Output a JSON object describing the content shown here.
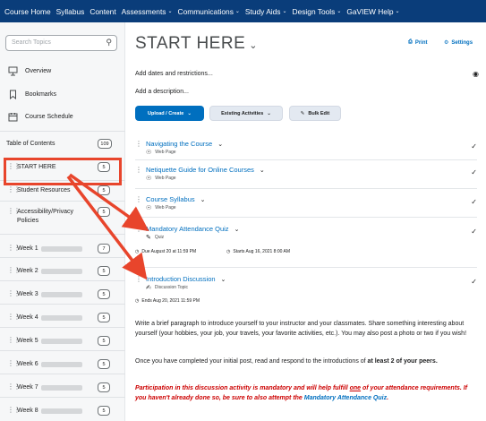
{
  "nav": {
    "items": [
      {
        "label": "Course Home",
        "menu": false
      },
      {
        "label": "Syllabus",
        "menu": false
      },
      {
        "label": "Content",
        "menu": false
      },
      {
        "label": "Assessments",
        "menu": true
      },
      {
        "label": "Communications",
        "menu": true
      },
      {
        "label": "Study Aids",
        "menu": true
      },
      {
        "label": "Design Tools",
        "menu": true
      },
      {
        "label": "GaVIEW Help",
        "menu": true
      }
    ]
  },
  "sidebar": {
    "search_placeholder": "Search Topics",
    "overview": "Overview",
    "bookmarks": "Bookmarks",
    "schedule": "Course Schedule",
    "toc_label": "Table of Contents",
    "toc_count": "109",
    "modules": [
      {
        "name": "START HERE",
        "count": "5"
      },
      {
        "name": "Student Resources",
        "count": "5"
      },
      {
        "name": "Accessibility/Privacy Policies",
        "count": "5"
      },
      {
        "name": "Week 1",
        "count": "7"
      },
      {
        "name": "Week 2",
        "count": "5"
      },
      {
        "name": "Week 3",
        "count": "5"
      },
      {
        "name": "Week 4",
        "count": "5"
      },
      {
        "name": "Week 5",
        "count": "5"
      },
      {
        "name": "Week 6",
        "count": "5"
      },
      {
        "name": "Week 7",
        "count": "5"
      },
      {
        "name": "Week 8",
        "count": "5"
      }
    ]
  },
  "main": {
    "title": "START HERE",
    "print": "Print",
    "settings": "Settings",
    "add_dates": "Add dates and restrictions...",
    "add_description": "Add a description...",
    "upload_create": "Upload / Create",
    "existing_activities": "Existing Activities",
    "bulk_edit": "Bulk Edit",
    "items": [
      {
        "title": "Navigating the Course",
        "type": "Web Page"
      },
      {
        "title": "Netiquette Guide for Online Courses",
        "type": "Web Page"
      },
      {
        "title": "Course Syllabus",
        "type": "Web Page"
      },
      {
        "title": "Mandatory Attendance Quiz",
        "type": "Quiz"
      },
      {
        "title": "Introduction Discussion",
        "type": "Discussion Topic"
      }
    ],
    "quiz_due": "Due August 20 at 11:59 PM",
    "quiz_starts": "Starts Aug 16, 2021 8:00 AM",
    "discussion_ends": "Ends Aug 20, 2021 11:59 PM",
    "para1": "Write a brief paragraph to introduce yourself to your instructor and your classmates.  Share something interesting about yourself (your hobbies, your job, your travels, your favorite activities, etc.). You may also post a photo or two if you wish!",
    "para2_a": "Once you have completed your initial post, read and respond to the introductions of ",
    "para2_b": "at least 2 of your peers",
    "para2_c": ".",
    "note_a": "Participation in this discussion activity is mandatory and will help fulfill ",
    "note_one": "one",
    "note_b": " of your attendance requirements. If you haven't already done so, be sure to also attempt the ",
    "note_link": "Mandatory Attendance Quiz",
    "note_c": "."
  },
  "colors": {
    "nav_bg": "#0a3d7a",
    "link": "#006fbf",
    "highlight": "#e8452c",
    "note": "#cc0000"
  }
}
